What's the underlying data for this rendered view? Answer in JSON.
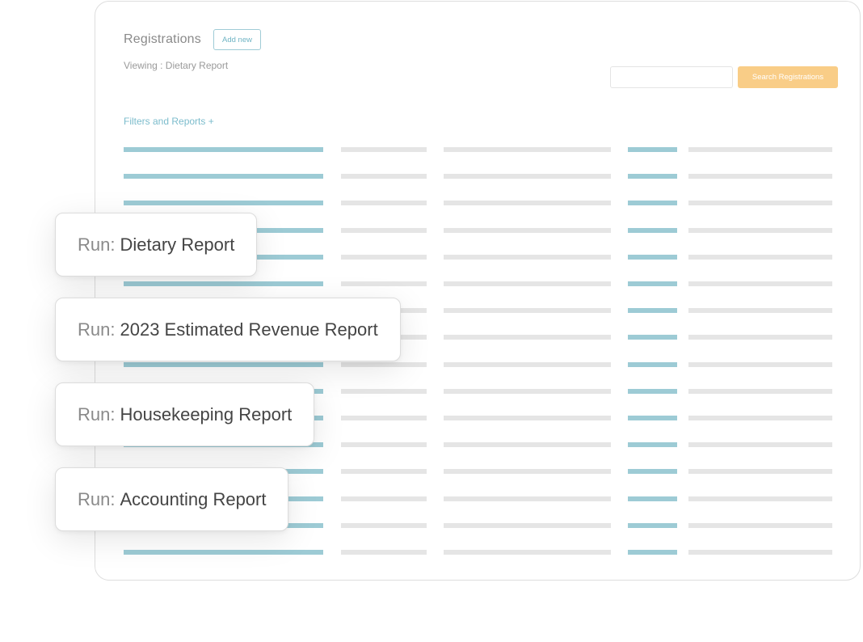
{
  "header": {
    "title": "Registrations",
    "add_new_label": "Add new",
    "viewing_text": "Viewing : Dietary Report"
  },
  "search": {
    "placeholder": "",
    "button_label": "Search Registrations"
  },
  "filters": {
    "label": "Filters and Reports +"
  },
  "table": {
    "row_count": 16,
    "note": "rows are skeleton placeholder bars without visible text"
  },
  "run_cards": [
    {
      "prefix": "Run:",
      "name": "Dietary Report"
    },
    {
      "prefix": "Run:",
      "name": "2023 Estimated Revenue Report"
    },
    {
      "prefix": "Run:",
      "name": "Housekeeping Report"
    },
    {
      "prefix": "Run:",
      "name": "Accounting Report"
    }
  ],
  "colors": {
    "accent_blue": "#9dcbd5",
    "placeholder_gray": "#e5e5e5",
    "search_button": "#f9cd87",
    "link_blue": "#7cbccc"
  }
}
